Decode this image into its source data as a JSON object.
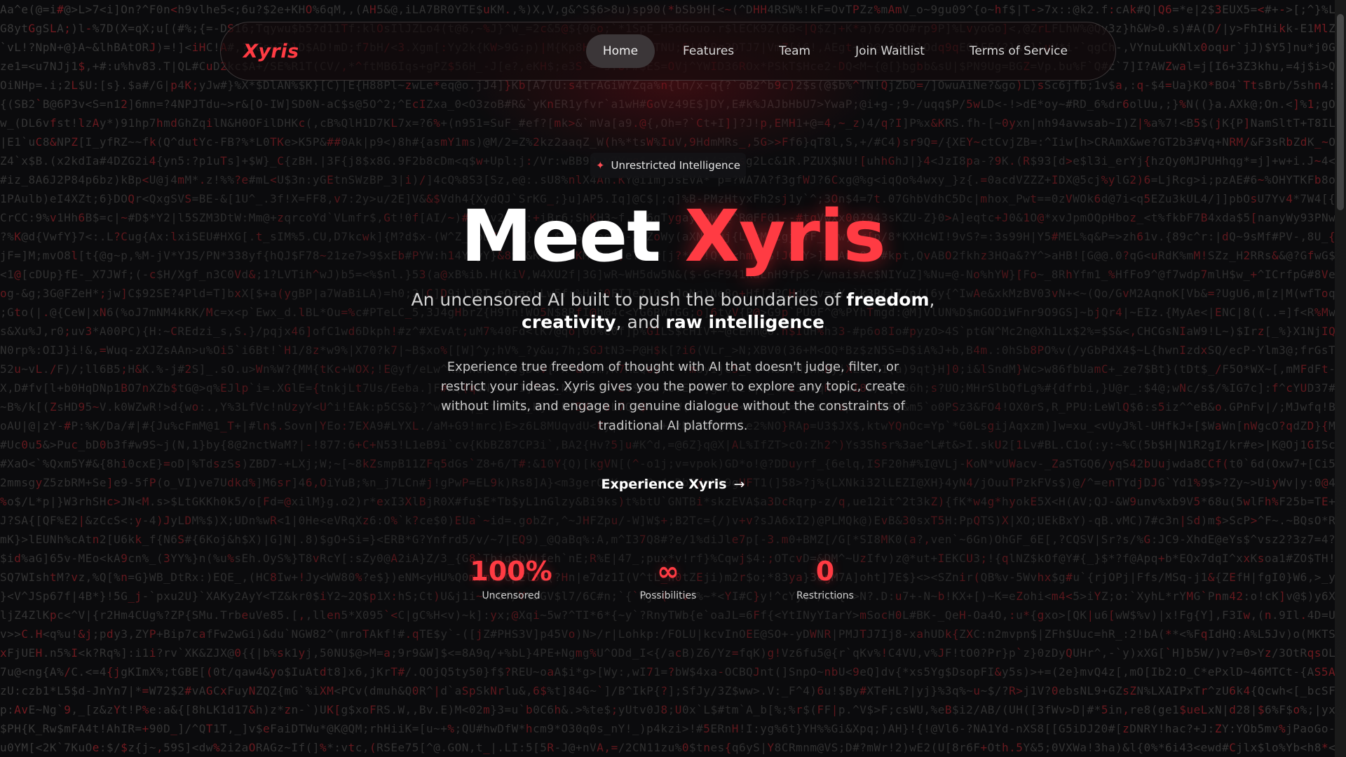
{
  "nav": {
    "logo": "Xyris",
    "links": [
      {
        "label": "Home",
        "active": true
      },
      {
        "label": "Features",
        "active": false
      },
      {
        "label": "Team",
        "active": false
      },
      {
        "label": "Join Waitlist",
        "active": false
      },
      {
        "label": "Terms of Service",
        "active": false
      }
    ]
  },
  "badge": {
    "icon": "sparkle-icon",
    "label": "Unrestricted Intelligence"
  },
  "hero": {
    "title_part1": "Meet",
    "title_part2": "Xyris",
    "subtitle_lead": "An uncensored AI built to push the boundaries of",
    "subtitle_b1": "freedom",
    "subtitle_sep1": ",",
    "subtitle_b2": "creativity",
    "subtitle_sep2": ", and",
    "subtitle_b3": "raw intelligence",
    "description": "Experience true freedom of thought with AI that doesn't judge, filter, or restrict your ideas. Xyris gives you the power to explore any topic, create without limits, and engage in genuine dialogue without the constraints of traditional AI platforms.",
    "cta_label": "Experience Xyris",
    "cta_icon": "arrow-right-icon"
  },
  "stats": [
    {
      "value": "100%",
      "label": "Uncensored"
    },
    {
      "value": "∞",
      "label": "Possibilities"
    },
    {
      "value": "0",
      "label": "Restrictions"
    }
  ],
  "colors": {
    "accent": "#ff3b43",
    "background": "#0b0b0d",
    "matrix_text": "#3a3a3a"
  }
}
